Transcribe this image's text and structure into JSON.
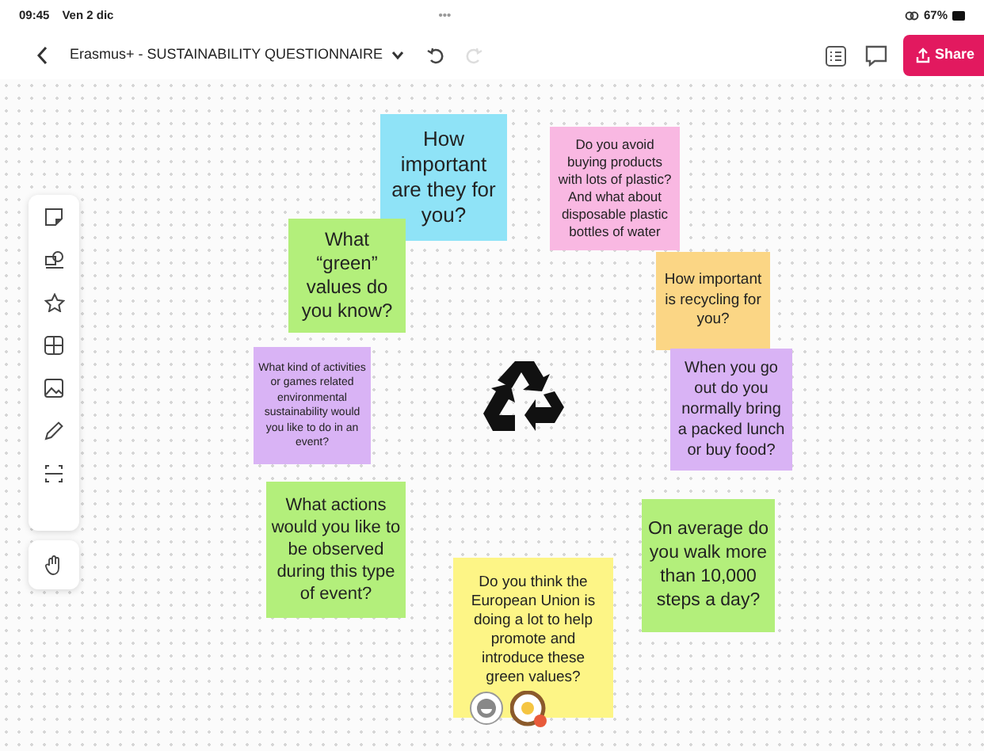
{
  "status_bar": {
    "time": "09:45",
    "date": "Ven 2 dic",
    "dots": "•••",
    "battery": "67%"
  },
  "toolbar": {
    "title": "Erasmus+ - SUSTAINABILITY QUESTIONNAIRE",
    "undo": {
      "disabled": false
    },
    "redo": {
      "disabled": true
    },
    "share": "Share"
  },
  "notes": [
    {
      "text": "How important are they for you?",
      "color": "#8fe3f7"
    },
    {
      "text": "Do you avoid buying products with lots of plastic? And what about disposable plastic bottles of water",
      "color": "#f9b8e2"
    },
    {
      "text": "What “green” values do you know?",
      "color": "#b3ef7b"
    },
    {
      "text": "How important is recycling for you?",
      "color": "#fbd685"
    },
    {
      "text": "What kind of activities or games related environmental sustainability would you like to do in an event?",
      "color": "#d9b3f5"
    },
    {
      "text": "When you go out do you normally bring a packed lunch or buy food?",
      "color": "#d9b3f5"
    },
    {
      "text": "What actions would you like to be observed during this type of event?",
      "color": "#b3ef7b"
    },
    {
      "text": "On average do you walk more than 10,000 steps a day?",
      "color": "#b3ef7b"
    },
    {
      "text": "Do you think the European Union is doing a lot to help promote and introduce these green values?",
      "color": "#fdf586"
    }
  ]
}
